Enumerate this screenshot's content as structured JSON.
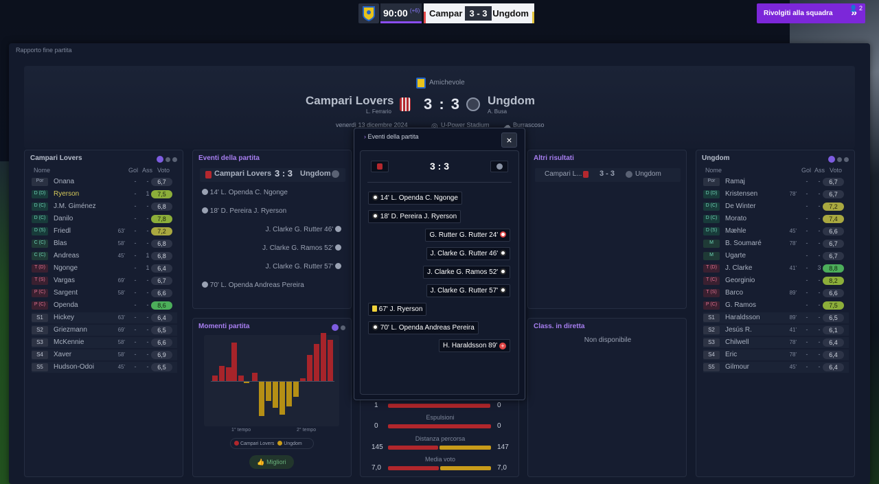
{
  "hud": {
    "time": "90:00",
    "added": "(+6)",
    "home_short": "Campar",
    "score": "3 - 3",
    "away_short": "Ungdom",
    "back_button": "Rivolgiti alla squadra",
    "notif_count": "2"
  },
  "page": {
    "title": "Rapporto fine partita"
  },
  "header": {
    "competition": "Amichevole",
    "home": "Campari Lovers",
    "home_coach": "L. Ferrario",
    "score": "3 : 3",
    "away": "Ungdom",
    "away_coach": "A. Busa",
    "date": "venerdì 13 dicembre 2024",
    "stadium": "U-Power Stadium",
    "weather": "Burrascoso"
  },
  "home_panel": {
    "title": "Campari Lovers",
    "col_name": "Nome",
    "col_gol": "Gol",
    "col_ass": "Ass",
    "col_voto": "Voto",
    "players": [
      {
        "pos": "Por",
        "name": "Onana",
        "meta": "",
        "gol": "-",
        "ass": "-",
        "rating": "6,7"
      },
      {
        "pos": "D (D)",
        "name": "Ryerson",
        "meta": "",
        "gol": "-",
        "ass": "1",
        "rating": "7,5"
      },
      {
        "pos": "D (C)",
        "name": "J.M. Giménez",
        "meta": "",
        "gol": "-",
        "ass": "-",
        "rating": "6,8"
      },
      {
        "pos": "D (C)",
        "name": "Danilo",
        "meta": "",
        "gol": "-",
        "ass": "-",
        "rating": "7,8"
      },
      {
        "pos": "D (S)",
        "name": "Friedl",
        "meta": "63'",
        "gol": "-",
        "ass": "-",
        "rating": "7,2"
      },
      {
        "pos": "C (C)",
        "name": "Blas",
        "meta": "58'",
        "gol": "-",
        "ass": "-",
        "rating": "6,8"
      },
      {
        "pos": "C (C)",
        "name": "Andreas",
        "meta": "45'",
        "gol": "-",
        "ass": "1",
        "rating": "6,8"
      },
      {
        "pos": "T (D)",
        "name": "Ngonge",
        "meta": "",
        "gol": "-",
        "ass": "1",
        "rating": "6,4"
      },
      {
        "pos": "T (S)",
        "name": "Vargas",
        "meta": "69'",
        "gol": "-",
        "ass": "-",
        "rating": "6,7"
      },
      {
        "pos": "P (C)",
        "name": "Sargent",
        "meta": "58'",
        "gol": "-",
        "ass": "-",
        "rating": "6,6"
      },
      {
        "pos": "P (C)",
        "name": "Openda",
        "meta": "",
        "gol": "-",
        "ass": "-",
        "rating": "8,6"
      },
      {
        "pos": "S1",
        "name": "Hickey",
        "meta": "63'",
        "gol": "-",
        "ass": "-",
        "rating": "6,4"
      },
      {
        "pos": "S2",
        "name": "Griezmann",
        "meta": "69'",
        "gol": "-",
        "ass": "-",
        "rating": "6,5"
      },
      {
        "pos": "S3",
        "name": "McKennie",
        "meta": "58'",
        "gol": "-",
        "ass": "-",
        "rating": "6,6"
      },
      {
        "pos": "S4",
        "name": "Xaver",
        "meta": "58'",
        "gol": "-",
        "ass": "-",
        "rating": "6,9"
      },
      {
        "pos": "S5",
        "name": "Hudson-Odoi",
        "meta": "45'",
        "gol": "-",
        "ass": "-",
        "rating": "6,5"
      }
    ]
  },
  "away_panel": {
    "title": "Ungdom",
    "col_name": "Nome",
    "col_gol": "Gol",
    "col_ass": "Ass",
    "col_voto": "Voto",
    "players": [
      {
        "pos": "Por",
        "name": "Ramaj",
        "meta": "",
        "gol": "-",
        "ass": "-",
        "rating": "6,7"
      },
      {
        "pos": "D (D)",
        "name": "Kristensen",
        "meta": "78'",
        "gol": "-",
        "ass": "-",
        "rating": "6,7"
      },
      {
        "pos": "D (C)",
        "name": "De Winter",
        "meta": "",
        "gol": "-",
        "ass": "-",
        "rating": "7,2"
      },
      {
        "pos": "D (C)",
        "name": "Morato",
        "meta": "",
        "gol": "-",
        "ass": "-",
        "rating": "7,4"
      },
      {
        "pos": "D (S)",
        "name": "Mæhle",
        "meta": "45'",
        "gol": "-",
        "ass": "-",
        "rating": "6,6"
      },
      {
        "pos": "M",
        "name": "B. Soumaré",
        "meta": "78'",
        "gol": "-",
        "ass": "-",
        "rating": "6,7"
      },
      {
        "pos": "M",
        "name": "Ugarte",
        "meta": "",
        "gol": "-",
        "ass": "-",
        "rating": "6,7"
      },
      {
        "pos": "T (D)",
        "name": "J. Clarke",
        "meta": "41'",
        "gol": "-",
        "ass": "3",
        "rating": "8,8"
      },
      {
        "pos": "T (C)",
        "name": "Georginio",
        "meta": "",
        "gol": "-",
        "ass": "-",
        "rating": "8,2"
      },
      {
        "pos": "T (S)",
        "name": "Barco",
        "meta": "89'",
        "gol": "-",
        "ass": "-",
        "rating": "6,6"
      },
      {
        "pos": "P (C)",
        "name": "G. Ramos",
        "meta": "",
        "gol": "-",
        "ass": "-",
        "rating": "7,5"
      },
      {
        "pos": "S1",
        "name": "Haraldsson",
        "meta": "89'",
        "gol": "-",
        "ass": "-",
        "rating": "6,5"
      },
      {
        "pos": "S2",
        "name": "Jesús R.",
        "meta": "41'",
        "gol": "-",
        "ass": "-",
        "rating": "6,1"
      },
      {
        "pos": "S3",
        "name": "Chilwell",
        "meta": "78'",
        "gol": "-",
        "ass": "-",
        "rating": "6,4"
      },
      {
        "pos": "S4",
        "name": "Eric",
        "meta": "78'",
        "gol": "-",
        "ass": "-",
        "rating": "6,4"
      },
      {
        "pos": "S5",
        "name": "Gilmour",
        "meta": "45'",
        "gol": "-",
        "ass": "-",
        "rating": "6,4"
      }
    ]
  },
  "events_panel": {
    "title": "Eventi della partita",
    "home": "Campari Lovers",
    "score": "3 : 3",
    "away": "Ungdom",
    "events": [
      {
        "text": "14'  L. Openda C. Ngonge",
        "side": "home"
      },
      {
        "text": "18'  D. Pereira J. Ryerson",
        "side": "home"
      },
      {
        "text": "J. Clarke G. Rutter 46'",
        "side": "away"
      },
      {
        "text": "J. Clarke G. Ramos 52'",
        "side": "away"
      },
      {
        "text": "J. Clarke G. Rutter 57'",
        "side": "away"
      },
      {
        "text": "70'  L. Openda Andreas Pereira",
        "side": "home"
      }
    ]
  },
  "moments": {
    "title": "Momenti partita",
    "first_half": "1° tempo",
    "second_half": "2° tempo",
    "legend_home": "Campari Lovers",
    "legend_away": "Ungdom",
    "best_button": "Migliori"
  },
  "other_results": {
    "title": "Altri risultati",
    "home": "Campari L...",
    "score": "3 - 3",
    "away": "Ungdom"
  },
  "live_table": {
    "title": "Class. in diretta",
    "empty": "Non disponibile"
  },
  "stats": [
    {
      "home": "1",
      "label": "Espulsioni",
      "away": "0"
    },
    {
      "home": "0",
      "label": "Distanza percorsa",
      "away": "0"
    },
    {
      "home": "145",
      "label": "Media voto",
      "away": "147"
    },
    {
      "home": "7,0",
      "label": "",
      "away": "7,0"
    }
  ],
  "overlay": {
    "title": "Eventi della partita",
    "score": "3 : 3",
    "events": [
      {
        "text": "14'  L. Openda C. Ngonge",
        "side": "home",
        "icon": "ball-icon"
      },
      {
        "text": "18'  D. Pereira J. Ryerson",
        "side": "home",
        "icon": "ball-icon"
      },
      {
        "text": "G. Rutter G. Rutter 24'",
        "side": "away",
        "icon": "own-goal-icon"
      },
      {
        "text": "J. Clarke G. Rutter 46'",
        "side": "away",
        "icon": "ball-icon"
      },
      {
        "text": "J. Clarke G. Ramos 52'",
        "side": "away",
        "icon": "ball-icon"
      },
      {
        "text": "J. Clarke G. Rutter 57'",
        "side": "away",
        "icon": "ball-icon"
      },
      {
        "text": "67'  J. Ryerson",
        "side": "home",
        "icon": "yellow-card-icon"
      },
      {
        "text": "70'  L. Openda Andreas Pereira",
        "side": "home",
        "icon": "ball-icon"
      },
      {
        "text": "H. Haraldsson 89'",
        "side": "away",
        "icon": "injury-icon"
      }
    ]
  }
}
